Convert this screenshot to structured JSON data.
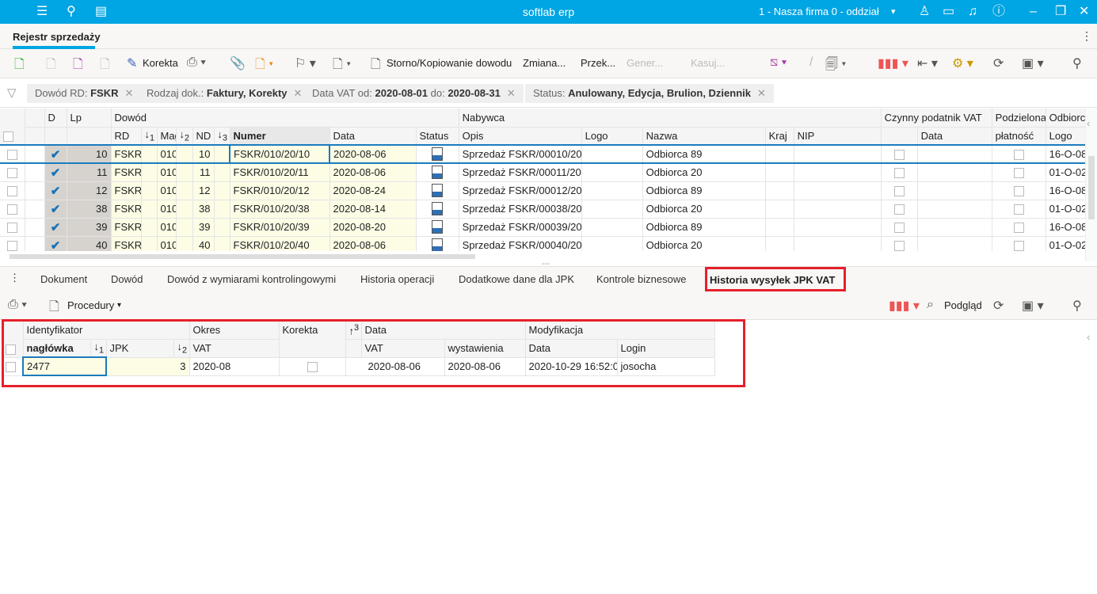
{
  "topbar": {
    "title": "softlab erp",
    "company": "1 - Nasza firma 0 - oddział"
  },
  "tab": {
    "label": "Rejestr sprzedaży"
  },
  "toolbar": {
    "korekta": "Korekta",
    "storno": "Storno/Kopiowanie dowodu",
    "zmiana": "Zmiana...",
    "przek": "Przek...",
    "gener": "Gener...",
    "kasuj": "Kasuj..."
  },
  "filters": [
    {
      "label": "Dowód RD:",
      "value": "FSKR"
    },
    {
      "label": "Rodzaj dok.:",
      "value": "Faktury, Korekty"
    },
    {
      "label": "Data VAT od:",
      "value": "2020-08-01",
      "label2": "do:",
      "value2": "2020-08-31"
    },
    {
      "label": "Status:",
      "value": "Anulowany, Edycja, Brulion, Dziennik"
    }
  ],
  "grid": {
    "group_headers": {
      "d": "D",
      "lp": "Lp",
      "dowod": "Dowód",
      "nabywca": "Nabywca",
      "czynny": "Czynny podatnik VAT",
      "podzielona": "Podzielona",
      "odbiorca": "Odbiorc"
    },
    "headers": {
      "rd": "RD",
      "mag": "Mag",
      "nd": "ND",
      "numer": "Numer",
      "data": "Data",
      "status": "Status",
      "opis": "Opis",
      "logo": "Logo",
      "nazwa": "Nazwa",
      "kraj": "Kraj",
      "nip": "NIP",
      "czdata": "Data",
      "platnosc": "płatność",
      "ologo": "Logo"
    },
    "rows": [
      {
        "lp": "10",
        "rd": "FSKR",
        "mag": "010",
        "nd": "10",
        "numer": "FSKR/010/20/10",
        "data": "2020-08-06",
        "opis": "Sprzedaż FSKR/00010/20",
        "nazwa": "Odbiorca 89",
        "ologo": "16-O-08"
      },
      {
        "lp": "11",
        "rd": "FSKR",
        "mag": "010",
        "nd": "11",
        "numer": "FSKR/010/20/11",
        "data": "2020-08-06",
        "opis": "Sprzedaż FSKR/00011/20",
        "nazwa": "Odbiorca 20",
        "ologo": "01-O-02"
      },
      {
        "lp": "12",
        "rd": "FSKR",
        "mag": "010",
        "nd": "12",
        "numer": "FSKR/010/20/12",
        "data": "2020-08-24",
        "opis": "Sprzedaż FSKR/00012/20",
        "nazwa": "Odbiorca 89",
        "ologo": "16-O-08"
      },
      {
        "lp": "38",
        "rd": "FSKR",
        "mag": "010",
        "nd": "38",
        "numer": "FSKR/010/20/38",
        "data": "2020-08-14",
        "opis": "Sprzedaż FSKR/00038/20",
        "nazwa": "Odbiorca 20",
        "ologo": "01-O-02"
      },
      {
        "lp": "39",
        "rd": "FSKR",
        "mag": "010",
        "nd": "39",
        "numer": "FSKR/010/20/39",
        "data": "2020-08-20",
        "opis": "Sprzedaż FSKR/00039/20",
        "nazwa": "Odbiorca 89",
        "ologo": "16-O-08"
      },
      {
        "lp": "40",
        "rd": "FSKR",
        "mag": "010",
        "nd": "40",
        "numer": "FSKR/010/20/40",
        "data": "2020-08-06",
        "opis": "Sprzedaż FSKR/00040/20",
        "nazwa": "Odbiorca 20",
        "ologo": "01-O-02"
      }
    ]
  },
  "detail_tabs": [
    "Dokument",
    "Dowód",
    "Dowód z wymiarami kontrolingowymi",
    "Historia operacji",
    "Dodatkowe dane dla JPK",
    "Kontrole biznesowe",
    "Historia wysyłek JPK VAT"
  ],
  "detail_toolbar": {
    "procedury": "Procedury",
    "podglad": "Podgląd"
  },
  "detail": {
    "group_headers": {
      "identyfikator": "Identyfikator",
      "okres": "Okres",
      "korekta": "Korekta",
      "data": "Data",
      "modyfikacja": "Modyfikacja"
    },
    "headers": {
      "naglowka": "nagłówka",
      "jpk": "JPK",
      "vat": "VAT",
      "dvat": "VAT",
      "wystawienia": "wystawienia",
      "mdata": "Data",
      "login": "Login"
    },
    "row": {
      "id": "2477",
      "jpk": "3",
      "okres": "2020-08",
      "data_vat": "2020-08-06",
      "wystawienia": "2020-08-06",
      "mod_data": "2020-10-29 16:52:0",
      "login": "josocha"
    }
  },
  "colors": {
    "accent": "#00a5e3",
    "highlight": "#e5202a",
    "selection": "#1a7bbf"
  }
}
